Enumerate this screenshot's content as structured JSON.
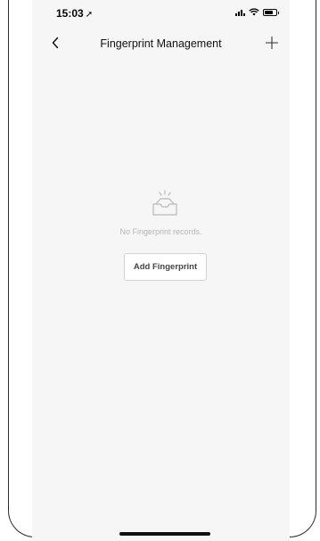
{
  "status_bar": {
    "time": "15:03",
    "location_icon": "location-arrow-icon",
    "signal_icon": "signal-icon",
    "wifi_icon": "wifi-icon",
    "battery_icon": "battery-icon"
  },
  "nav": {
    "title": "Fingerprint Management",
    "back_icon": "chevron-left-icon",
    "add_icon": "plus-icon"
  },
  "empty_state": {
    "icon": "empty-tray-icon",
    "message": "No Fingerprint records.",
    "button_label": "Add Fingerprint"
  },
  "colors": {
    "background": "#f6f6f6",
    "empty_text": "#b5b5b5",
    "button_border": "#d3d3d3"
  }
}
